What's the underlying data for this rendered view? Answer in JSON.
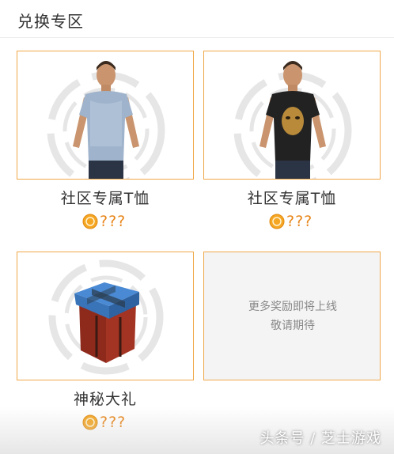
{
  "header": {
    "title": "兑换专区"
  },
  "items": [
    {
      "name": "社区专属T恤",
      "price": "???",
      "image": "blue-tshirt-character",
      "shirt_color": "#9fb4cc"
    },
    {
      "name": "社区专属T恤",
      "price": "???",
      "image": "black-tshirt-character",
      "shirt_color": "#222222"
    },
    {
      "name": "神秘大礼",
      "price": "???",
      "image": "supply-crate"
    }
  ],
  "placeholder": {
    "line1": "更多奖励即将上线",
    "line2": "敬请期待"
  },
  "watermark": "头条号 / 芝士游戏",
  "colors": {
    "accent_border": "#f0a84a",
    "price": "#e8871c",
    "coin": "#f5a623"
  }
}
